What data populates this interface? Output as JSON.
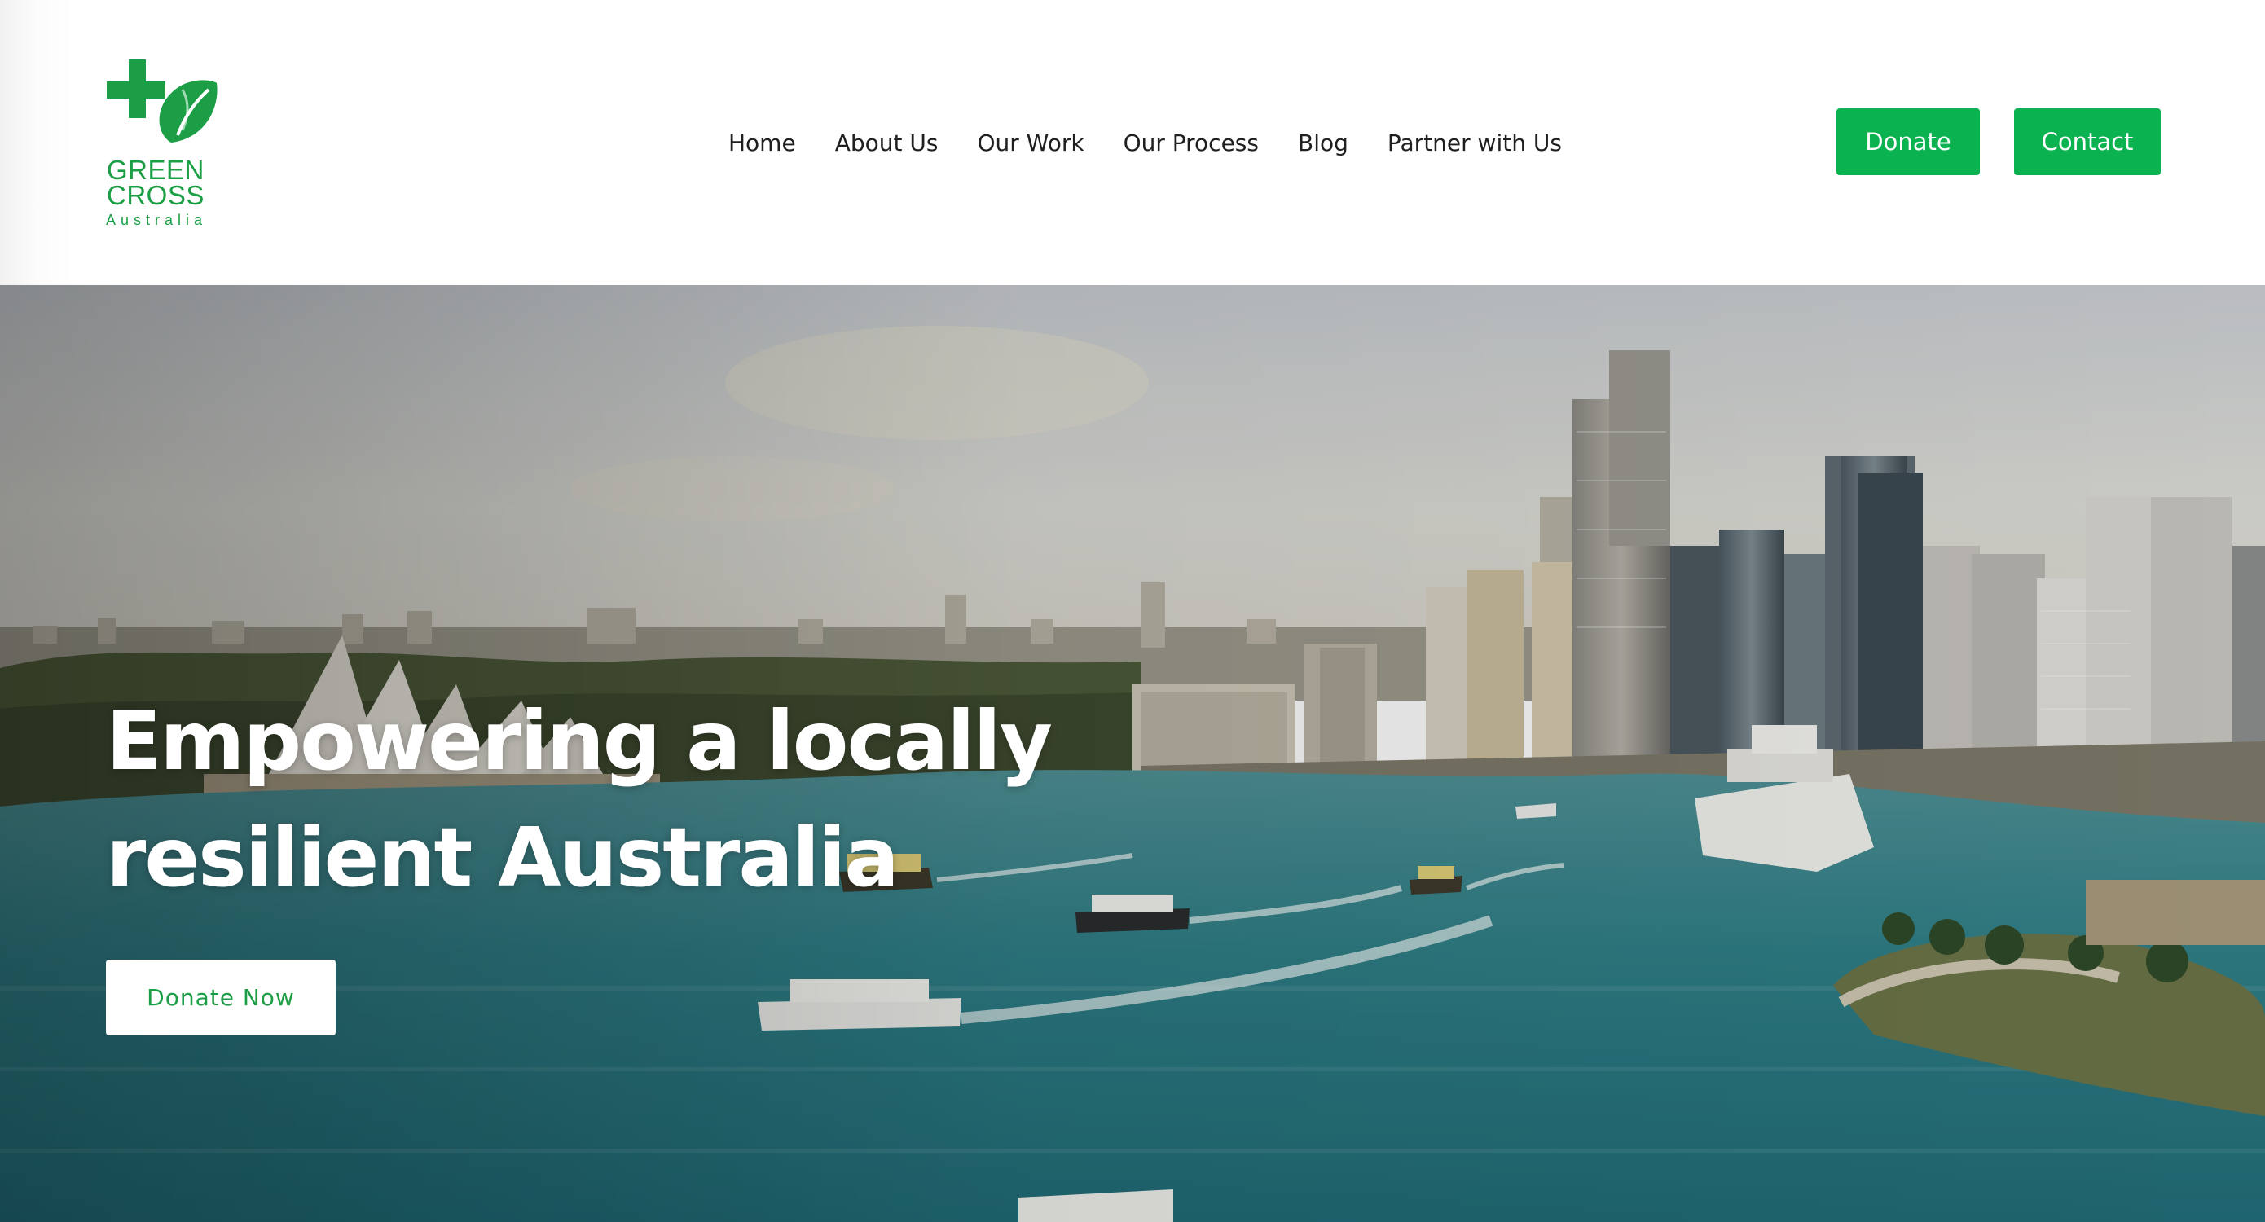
{
  "colors": {
    "brand_green": "#0bb350",
    "logo_green": "#1b9e45",
    "nav_text": "#1f1f1f",
    "hero_text": "#ffffff",
    "water": "#2f7f87"
  },
  "logo": {
    "icon": "green-cross-leaf-icon",
    "line1": "GREEN",
    "line2": "CROSS",
    "line3": "Australia"
  },
  "nav": {
    "items": [
      {
        "label": "Home"
      },
      {
        "label": "About Us"
      },
      {
        "label": "Our Work"
      },
      {
        "label": "Our Process"
      },
      {
        "label": "Blog"
      },
      {
        "label": "Partner with Us"
      }
    ]
  },
  "header_buttons": {
    "donate": "Donate",
    "contact": "Contact"
  },
  "hero": {
    "background": "Sydney harbour aerial photo with Opera House, city skyline and ferries",
    "title_line1": "Empowering a locally",
    "title_line2": "resilient Australia",
    "cta": "Donate Now"
  }
}
